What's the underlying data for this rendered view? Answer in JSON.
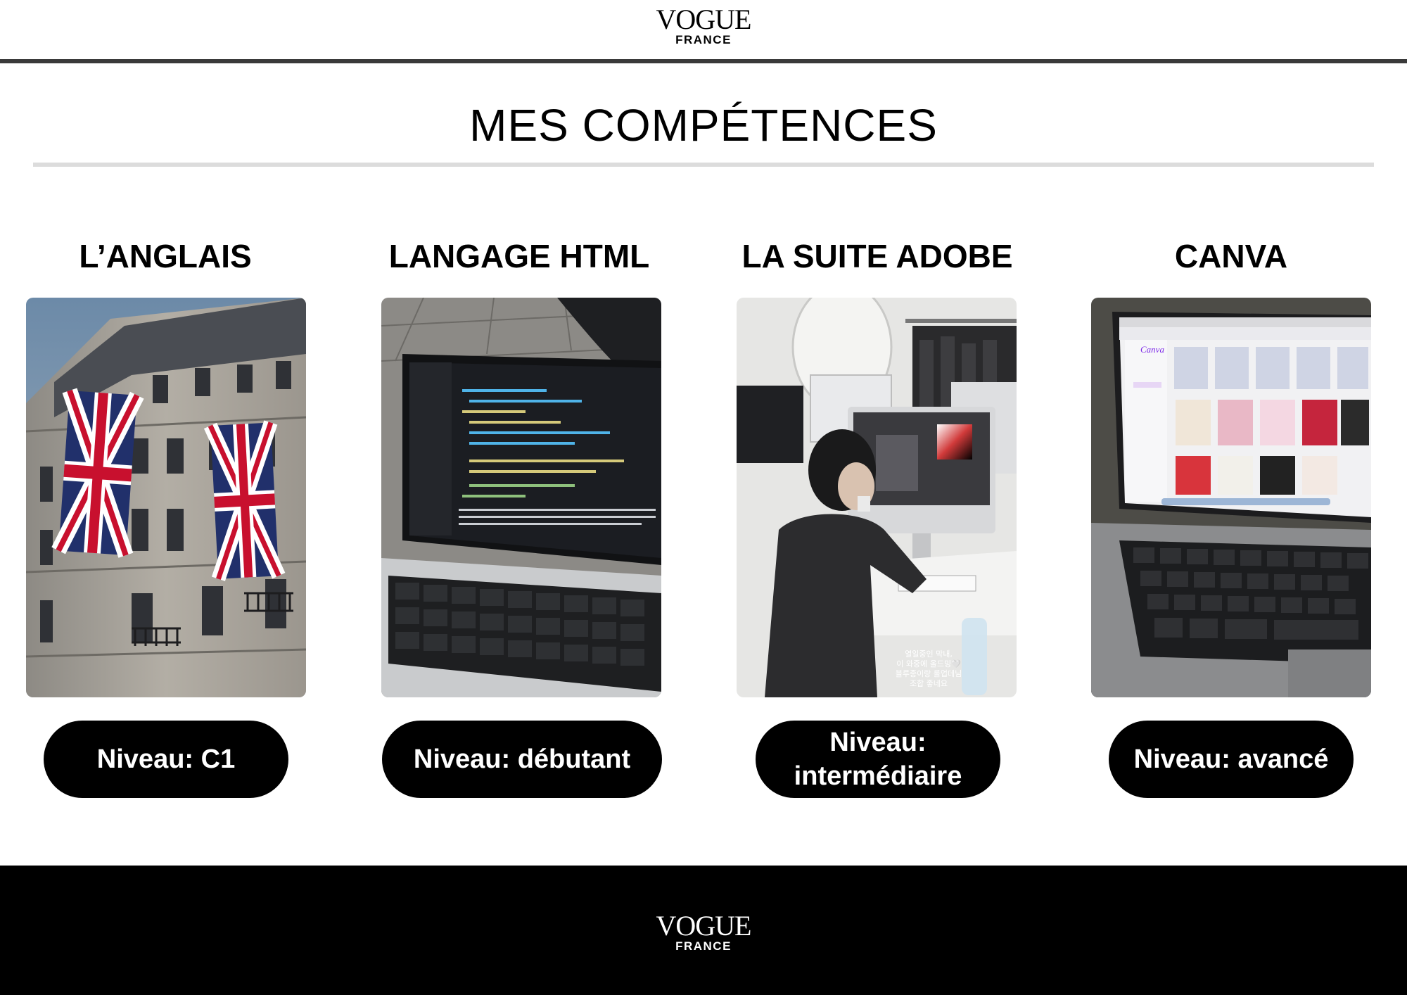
{
  "header": {
    "logo_main": "VOGUE",
    "logo_sub": "FRANCE"
  },
  "page": {
    "title": "MES COMPÉTENCES"
  },
  "skills": [
    {
      "title": "L’ANGLAIS",
      "level": "Niveau: C1",
      "photo_icon": "union-jack-flags-photo"
    },
    {
      "title": "LANGAGE HTML",
      "level": "Niveau: débutant",
      "photo_icon": "laptop-code-photo"
    },
    {
      "title": "LA SUITE ADOBE",
      "level": "Niveau: intermédiaire",
      "photo_icon": "designer-at-imac-photo",
      "photo_caption": [
        "열일중인 막내,",
        "이 와중에 올드밍🤍",
        "블루종이랑 롤업데님",
        "조합 좋네요"
      ]
    },
    {
      "title": "CANVA",
      "level": "Niveau: avancé",
      "photo_icon": "macbook-canva-photo",
      "screen_brand": "Canva"
    }
  ],
  "footer": {
    "logo_main": "VOGUE",
    "logo_sub": "FRANCE"
  },
  "colors": {
    "background": "#ffffff",
    "pill": "#000000",
    "footer": "#000000",
    "header_rule": "#3a3a3a",
    "title_rule": "#dcdcdc"
  }
}
